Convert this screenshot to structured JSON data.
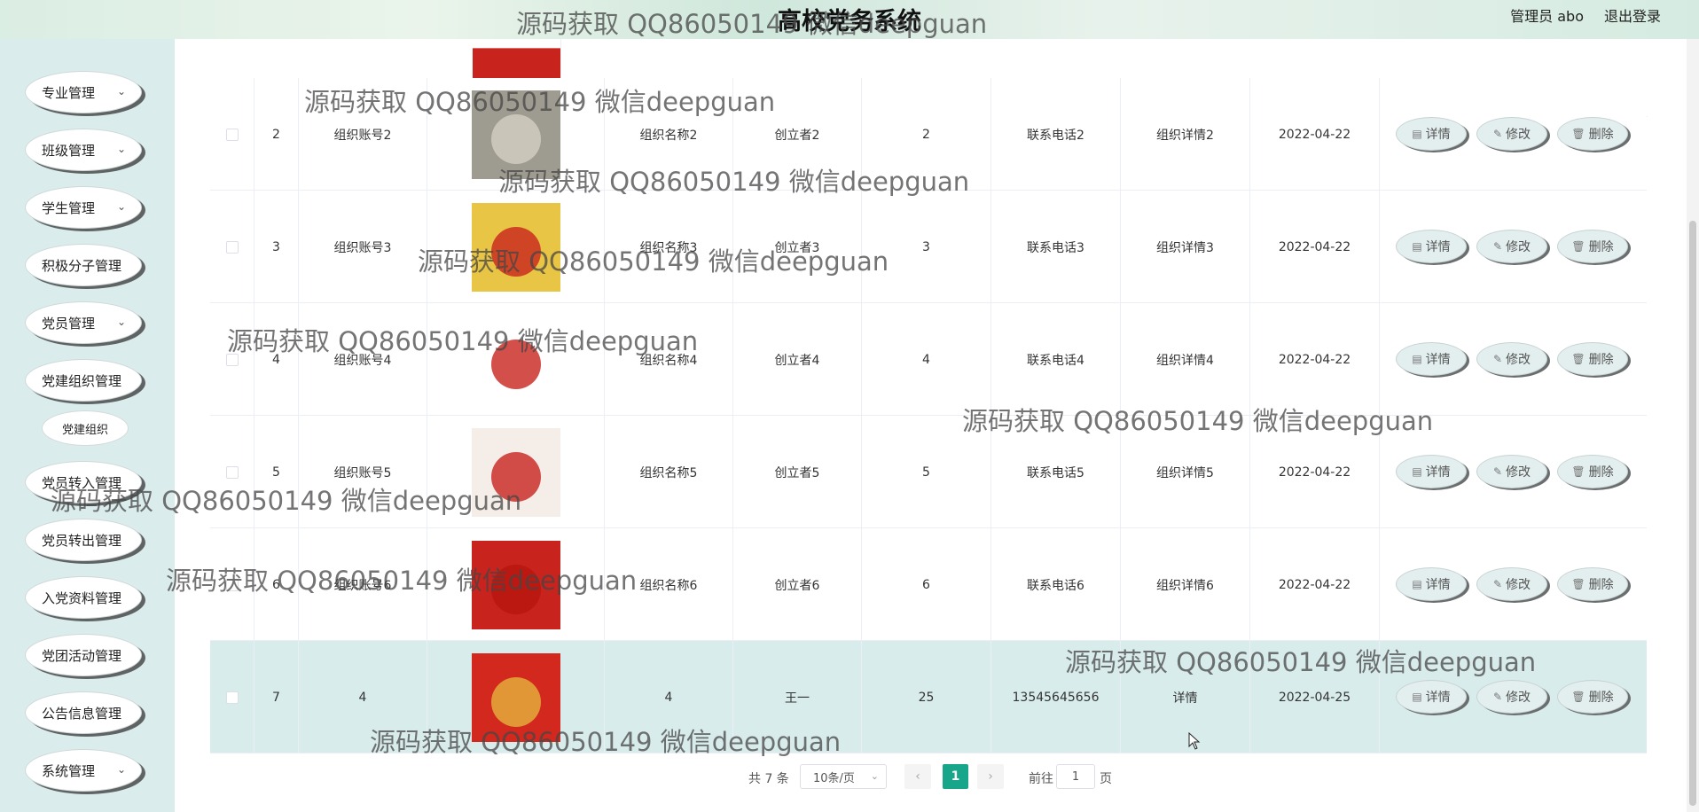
{
  "header": {
    "title": "高校党务系统",
    "user": "管理员 abo",
    "logout": "退出登录"
  },
  "sidebar": {
    "items": [
      {
        "label": "专业管理",
        "chevron": true
      },
      {
        "label": "班级管理",
        "chevron": true
      },
      {
        "label": "学生管理",
        "chevron": true
      },
      {
        "label": "积极分子管理",
        "chevron": false
      },
      {
        "label": "党员管理",
        "chevron": true
      },
      {
        "label": "党建组织管理",
        "chevron": false
      },
      {
        "label": "党员转入管理",
        "chevron": false
      },
      {
        "label": "党员转出管理",
        "chevron": false
      },
      {
        "label": "入党资料管理",
        "chevron": false
      },
      {
        "label": "党团活动管理",
        "chevron": false
      },
      {
        "label": "公告信息管理",
        "chevron": false
      },
      {
        "label": "系统管理",
        "chevron": true
      }
    ],
    "submenu_label": "党建组织"
  },
  "table": {
    "rows": [
      {
        "index": "2",
        "account": "组织账号2",
        "name": "组织名称2",
        "creator": "创立者2",
        "count": "2",
        "phone": "联系电话2",
        "detail": "组织详情2",
        "date": "2022-04-22"
      },
      {
        "index": "3",
        "account": "组织账号3",
        "name": "组织名称3",
        "creator": "创立者3",
        "count": "3",
        "phone": "联系电话3",
        "detail": "组织详情3",
        "date": "2022-04-22"
      },
      {
        "index": "4",
        "account": "组织账号4",
        "name": "组织名称4",
        "creator": "创立者4",
        "count": "4",
        "phone": "联系电话4",
        "detail": "组织详情4",
        "date": "2022-04-22"
      },
      {
        "index": "5",
        "account": "组织账号5",
        "name": "组织名称5",
        "creator": "创立者5",
        "count": "5",
        "phone": "联系电话5",
        "detail": "组织详情5",
        "date": "2022-04-22"
      },
      {
        "index": "6",
        "account": "组织账号6",
        "name": "组织名称6",
        "creator": "创立者6",
        "count": "6",
        "phone": "联系电话6",
        "detail": "组织详情6",
        "date": "2022-04-22"
      },
      {
        "index": "7",
        "account": "4",
        "name": "4",
        "creator": "王一",
        "count": "25",
        "phone": "13545645656",
        "detail": "详情",
        "date": "2022-04-25"
      }
    ],
    "buttons": {
      "detail": "详情",
      "edit": "修改",
      "delete": "删除"
    }
  },
  "pagination": {
    "total": "共 7 条",
    "page_size": "10条/页",
    "current_page": "1",
    "goto_label": "前往",
    "goto_value": "1",
    "page_unit": "页"
  },
  "watermark": "源码获取 QQ86050149 微信deepguan",
  "colors": {
    "accent": "#18a68a",
    "sidebar_bg": "#dbecec",
    "highlight_row": "#d9ecec"
  }
}
